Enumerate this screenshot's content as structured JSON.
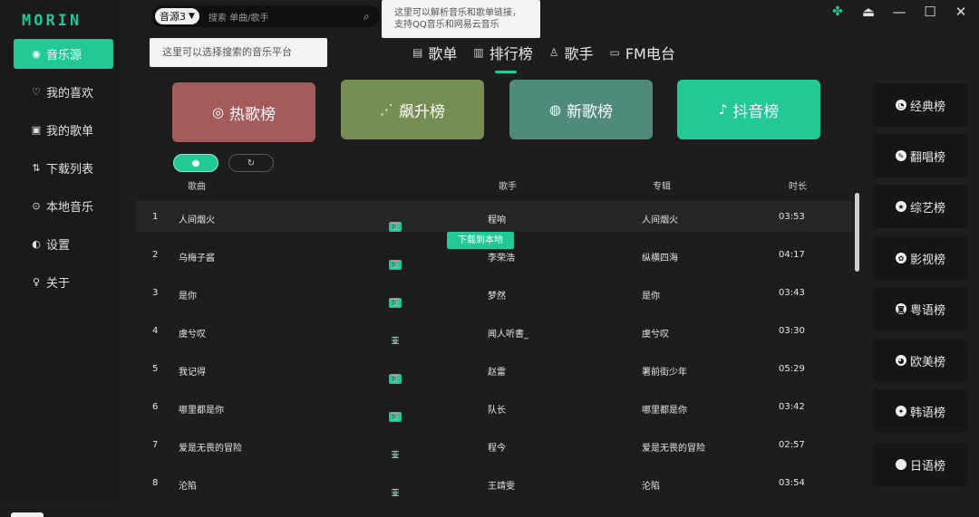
{
  "app": {
    "logo": "MORIN"
  },
  "sidebar": {
    "items": [
      {
        "label": "音乐源",
        "icon": "music-source-icon",
        "glyph": "◉",
        "active": true
      },
      {
        "label": "我的喜欢",
        "icon": "heart-icon",
        "glyph": "♡"
      },
      {
        "label": "我的歌单",
        "icon": "playlist-icon",
        "glyph": "▣"
      },
      {
        "label": "下载列表",
        "icon": "download-list-icon",
        "glyph": "⇅"
      },
      {
        "label": "本地音乐",
        "icon": "local-music-icon",
        "glyph": "⊙"
      },
      {
        "label": "设置",
        "icon": "settings-icon",
        "glyph": "◐"
      },
      {
        "label": "关于",
        "icon": "about-icon",
        "glyph": "♀"
      }
    ]
  },
  "search": {
    "source": "音源3",
    "placeholder": "搜索 单曲/歌手",
    "tip_source": "这里可以选择搜索的音乐平台",
    "tip_parse_1": "这里可以解析音乐和歌单链接，",
    "tip_parse_2": "支持QQ音乐和网易云音乐"
  },
  "tabs": [
    {
      "label": "歌单",
      "glyph": "▤"
    },
    {
      "label": "排行榜",
      "glyph": "▥",
      "active": true
    },
    {
      "label": "歌手",
      "glyph": "♙"
    },
    {
      "label": "FM电台",
      "glyph": "▭"
    }
  ],
  "cards": [
    {
      "label": "热歌榜",
      "glyph": "◎",
      "color": "#a55a5b"
    },
    {
      "label": "飙升榜",
      "glyph": "⋰",
      "color": "#768e52"
    },
    {
      "label": "新歌榜",
      "glyph": "◍",
      "color": "#4f8a7c"
    },
    {
      "label": "抖音榜",
      "glyph": "♪",
      "color": "#22c997"
    }
  ],
  "table": {
    "headers": {
      "title": "歌曲",
      "artist": "歌手",
      "album": "专辑",
      "duration": "时长"
    },
    "rows": [
      {
        "num": "1",
        "title": "人间烟火",
        "artist": "程响",
        "album": "人间烟火",
        "duration": "03:53",
        "mv": true
      },
      {
        "num": "2",
        "title": "乌梅子酱",
        "artist": "李荣浩",
        "album": "纵横四海",
        "duration": "04:17",
        "mv": true
      },
      {
        "num": "3",
        "title": "是你",
        "artist": "梦然",
        "album": "是你",
        "duration": "03:43",
        "mv": true
      },
      {
        "num": "4",
        "title": "虞兮叹",
        "artist": "闻人听書_",
        "album": "虞兮叹",
        "duration": "03:30",
        "mv": false
      },
      {
        "num": "5",
        "title": "我记得",
        "artist": "赵雷",
        "album": "署前街少年",
        "duration": "05:29",
        "mv": true
      },
      {
        "num": "6",
        "title": "哪里都是你",
        "artist": "队长",
        "album": "哪里都是你",
        "duration": "03:42",
        "mv": true
      },
      {
        "num": "7",
        "title": "爱是无畏的冒险",
        "artist": "程今",
        "album": "爱是无畏的冒险",
        "duration": "02:57",
        "mv": false
      },
      {
        "num": "8",
        "title": "沦陷",
        "artist": "王靖雯",
        "album": "沦陷",
        "duration": "03:54",
        "mv": false
      }
    ],
    "download_tip": "下载到本地"
  },
  "right_panel": [
    {
      "label": "经典榜",
      "glyph": "◔"
    },
    {
      "label": "翻唱榜",
      "glyph": "✎"
    },
    {
      "label": "综艺榜",
      "glyph": "★"
    },
    {
      "label": "影视榜",
      "glyph": "✿"
    },
    {
      "label": "粤语榜",
      "glyph": "◙"
    },
    {
      "label": "欧美榜",
      "glyph": "◕"
    },
    {
      "label": "韩语榜",
      "glyph": "✦"
    },
    {
      "label": "日语榜",
      "glyph": " "
    }
  ],
  "colors": {
    "accent": "#22c997",
    "background": "#1d1d1d"
  }
}
